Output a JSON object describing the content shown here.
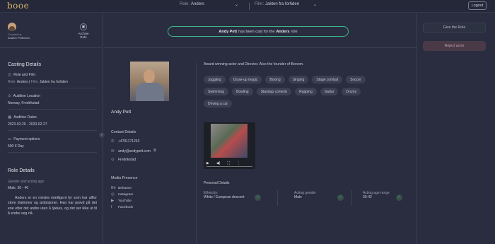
{
  "header": {
    "logo": "booe",
    "role_label": "Role:",
    "role_value": "Anders",
    "film_label": "Film:",
    "film_value": "Jakten fra fortiden",
    "logout": "Logout"
  },
  "sidebar": {
    "created_by_label": "Created by",
    "creator": "Anders Pettersen",
    "archive_label": "Archive Role",
    "casting_details_title": "Casting Details",
    "role_and_film_label": "Role and Film",
    "role_prefix": "Role:",
    "role_value": "Anders",
    "film_prefix": "Film:",
    "film_value": "Jakten fra fortiden",
    "audition_location_label": "Audition Location",
    "audition_location_value": "Norway, Fredrikstad",
    "audition_dates_label": "Audition Dates",
    "audition_dates_value": "2023-02-20 - 2023-02-27",
    "payment_label": "Payment options",
    "payment_value": "500 € Day",
    "role_details_title": "Role Details",
    "gender_age_label": "Gender and acting age:",
    "gender_age_value": "Male, 30 - 40",
    "role_description": "Anders er en mindre intelligent fyr som har allfor store drømmer og ambisjoner. Han har prøvd på det ene etter det andre uten å lykkes, og det ser ikke ut til å endre seg nå."
  },
  "banner": {
    "actor": "Andy Pett",
    "middle": "has been cast for the",
    "role": "Anders",
    "suffix": "role"
  },
  "actor": {
    "name": "Andy Pett",
    "bio": "Award winning actor and Director. Also the founder of Booom.",
    "contact_title": "Contact Details",
    "phone": "+4791171263",
    "email": "andy@andypett.com",
    "location": "Fredrikstad",
    "media_title": "Media Presence",
    "media": [
      "Behance",
      "Instagram",
      "YouTube",
      "Facebook"
    ],
    "skills": [
      "Juggling",
      "Close-up magic",
      "Boxing",
      "Singing",
      "Stage combat",
      "Soccer",
      "Swimming",
      "Bowling",
      "Standup comedy",
      "Rapping",
      "Guitar",
      "Drums",
      "Driving a car"
    ]
  },
  "personal": {
    "title": "Personal Details",
    "ethnicity_label": "Ethnicity:",
    "ethnicity_value": "White / European descent",
    "gender_label": "Acting gender",
    "gender_value": "Male",
    "age_label": "Acting age range",
    "age_value": "30-42"
  },
  "actions": {
    "give_role": "Give the Role",
    "reject": "Reject actor"
  }
}
